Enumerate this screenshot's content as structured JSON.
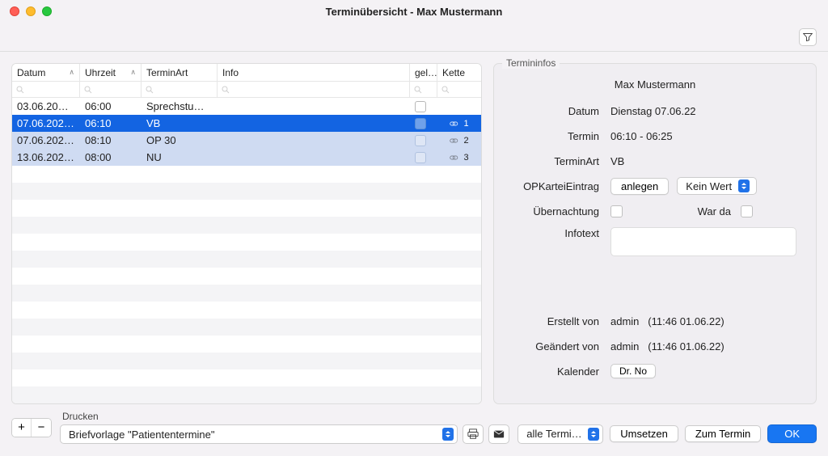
{
  "window": {
    "title": "Terminübersicht - Max Mustermann"
  },
  "table": {
    "headers": {
      "datum": "Datum",
      "uhrzeit": "Uhrzeit",
      "terminart": "TerminArt",
      "info": "Info",
      "gel": "gel…",
      "kette": "Kette"
    },
    "rows": [
      {
        "datum": "03.06.20…",
        "uhrzeit": "06:00",
        "art": "Sprechstu…",
        "info": "",
        "kette": ""
      },
      {
        "datum": "07.06.202…",
        "uhrzeit": "06:10",
        "art": "VB",
        "info": "",
        "kette": "1",
        "selected": true
      },
      {
        "datum": "07.06.202…",
        "uhrzeit": "08:10",
        "art": "OP 30",
        "info": "",
        "kette": "2"
      },
      {
        "datum": "13.06.202…",
        "uhrzeit": "08:00",
        "art": "NU",
        "info": "",
        "kette": "3"
      }
    ]
  },
  "info": {
    "legend": "Termininfos",
    "patient": "Max Mustermann",
    "labels": {
      "datum": "Datum",
      "termin": "Termin",
      "terminart": "TerminArt",
      "opkartei": "OPKarteiEintrag",
      "uebernachtung": "Übernachtung",
      "warda": "War da",
      "infotext": "Infotext",
      "erstellt": "Erstellt von",
      "geaendert": "Geändert von",
      "kalender": "Kalender"
    },
    "values": {
      "datum": "Dienstag 07.06.22",
      "termin": "06:10 - 06:25",
      "terminart": "VB",
      "anlegen": "anlegen",
      "keinwert": "Kein Wert",
      "erstellt_user": "admin",
      "erstellt_ts": "(11:46 01.06.22)",
      "geaendert_user": "admin",
      "geaendert_ts": "(11:46 01.06.22)",
      "kalender": "Dr. No"
    }
  },
  "footer": {
    "drucken": "Drucken",
    "briefvorlage": "Briefvorlage \"Patiententermine\"",
    "alle_termine": "alle Termi…",
    "umsetzen": "Umsetzen",
    "zum_termin": "Zum Termin",
    "ok": "OK"
  }
}
